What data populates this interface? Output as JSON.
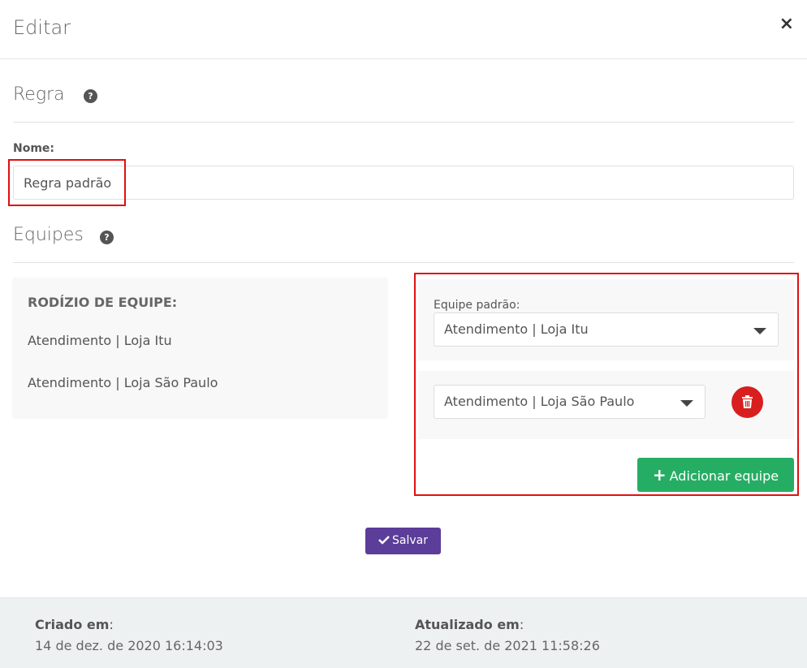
{
  "modal": {
    "title": "Editar",
    "close_label": "×"
  },
  "rule_section": {
    "title": "Regra",
    "help": "?"
  },
  "name_field": {
    "label": "Nome:",
    "value": "Regra padrão"
  },
  "teams_section": {
    "title": "Equipes",
    "help": "?"
  },
  "rotation": {
    "title": "RODÍZIO DE EQUIPE:",
    "items": [
      "Atendimento | Loja Itu",
      "Atendimento | Loja São Paulo"
    ]
  },
  "default_team": {
    "label": "Equipe padrão:",
    "selected": "Atendimento | Loja Itu"
  },
  "extra_team": {
    "selected": "Atendimento | Loja São Paulo"
  },
  "add_team_label": "Adicionar equipe",
  "save_label": "Salvar",
  "footer": {
    "created_label": "Criado em",
    "created_value": "14 de dez. de 2020 16:14:03",
    "updated_label": "Atualizado em",
    "updated_value": "22 de set. de 2021 11:58:26"
  },
  "colors": {
    "highlight": "#e01010",
    "save_button": "#5c3d99",
    "add_button": "#26ad64",
    "delete_button": "#d91e1e"
  },
  "icons": {
    "close": "close-icon",
    "help": "help-icon",
    "caret": "caret-down-icon",
    "delete": "trash-icon",
    "add": "plus-icon",
    "save": "check-icon"
  }
}
